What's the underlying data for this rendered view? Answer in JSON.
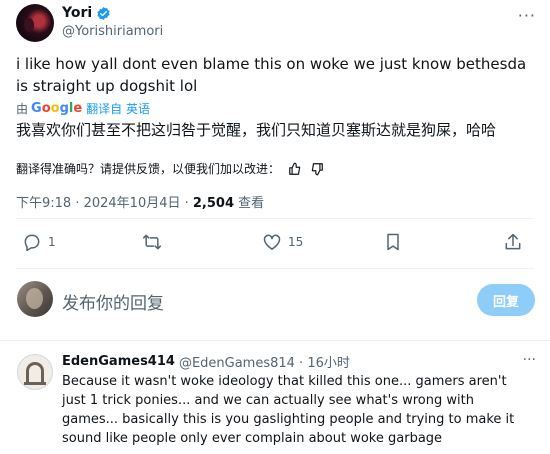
{
  "tweet": {
    "author_name": "Yori",
    "author_handle": "@Yorishiriamori",
    "text": "i like how yall dont even blame this on woke we just know bethesda is straight up dogshit lol",
    "translated_prefix": "由",
    "translated_link": "翻译自 英语",
    "translated_text": "我喜欢你们甚至不把这归咎于觉醒，我们只知道贝塞斯达就是狗屎，哈哈",
    "feedback_prompt": "翻译得准确吗？请提供反馈，以便我们加以改进：",
    "timestamp": "下午9:18 · 2024年10月4日 · ",
    "views_count": "2,504",
    "views_label": " 查看",
    "replies": "1",
    "likes": "15"
  },
  "compose": {
    "placeholder": "发布你的回复",
    "button": "回复"
  },
  "reply": {
    "name": "EdenGames414",
    "handle_time": "@EdenGames814 · 16小时",
    "text": "Because it wasn't woke ideology that killed this one... gamers aren't just 1 trick ponies... and we can actually see what's wrong with games... basically this is you gaslighting people and trying to make it sound like people only ever complain about woke garbage"
  },
  "colors": {
    "accent": "#1d9bf0",
    "reply_button_disabled": "#8ecdf8",
    "secondary_text": "#536471"
  },
  "icons": [
    "verified-badge-icon",
    "more-icon",
    "google-logo",
    "thumbs-up-icon",
    "thumbs-down-icon",
    "reply-icon",
    "retweet-icon",
    "like-icon",
    "bookmark-icon",
    "share-icon"
  ]
}
